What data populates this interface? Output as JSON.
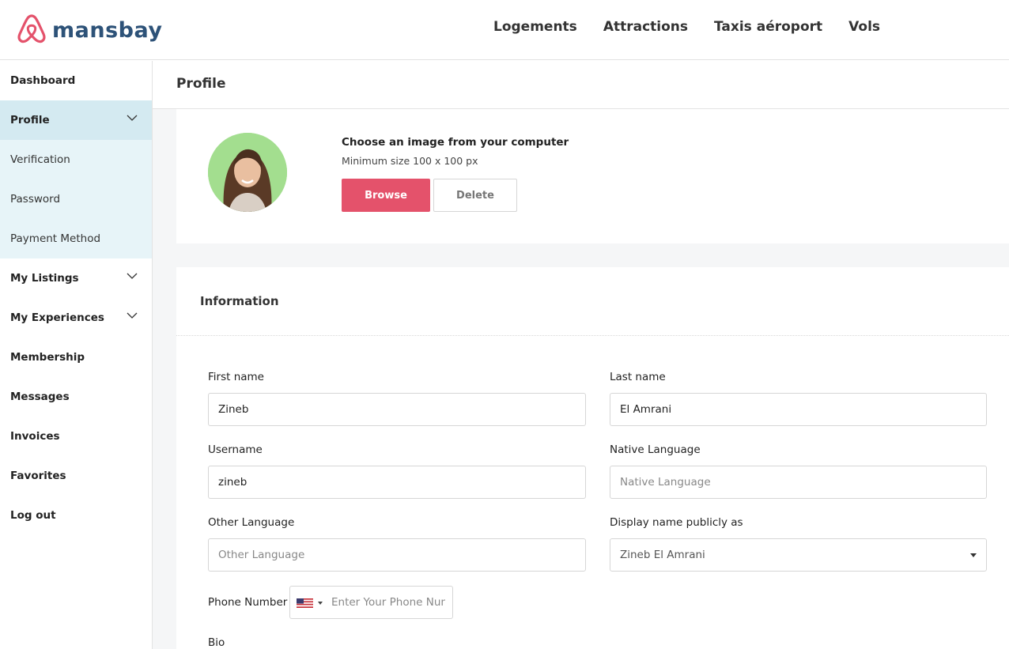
{
  "brand": {
    "name": "mansbay",
    "accent": "#e4526b",
    "text_color": "#2d5278"
  },
  "topnav": [
    "Logements",
    "Attractions",
    "Taxis aéroport",
    "Vols"
  ],
  "sidebar": {
    "items": [
      {
        "label": "Dashboard"
      },
      {
        "label": "Profile"
      },
      {
        "label": "Verification"
      },
      {
        "label": "Password"
      },
      {
        "label": "Payment Method"
      },
      {
        "label": "My Listings"
      },
      {
        "label": "My Experiences"
      },
      {
        "label": "Membership"
      },
      {
        "label": "Messages"
      },
      {
        "label": "Invoices"
      },
      {
        "label": "Favorites"
      },
      {
        "label": "Log out"
      }
    ]
  },
  "page": {
    "title": "Profile"
  },
  "avatar_card": {
    "title": "Choose an image from your computer",
    "subtitle": "Minimum size 100 x 100 px",
    "browse_label": "Browse",
    "delete_label": "Delete"
  },
  "info": {
    "title": "Information",
    "first_name": {
      "label": "First name",
      "value": "Zineb"
    },
    "last_name": {
      "label": "Last name",
      "value": "El Amrani"
    },
    "username": {
      "label": "Username",
      "value": "zineb"
    },
    "native_language": {
      "label": "Native Language",
      "placeholder": "Native Language"
    },
    "other_language": {
      "label": "Other Language",
      "placeholder": "Other Language"
    },
    "display_name": {
      "label": "Display name publicly as",
      "value": "Zineb El Amrani"
    },
    "phone": {
      "label": "Phone Number",
      "placeholder": "Enter Your Phone Number",
      "country_icon": "us-flag-icon"
    },
    "bio": {
      "label": "Bio"
    }
  }
}
